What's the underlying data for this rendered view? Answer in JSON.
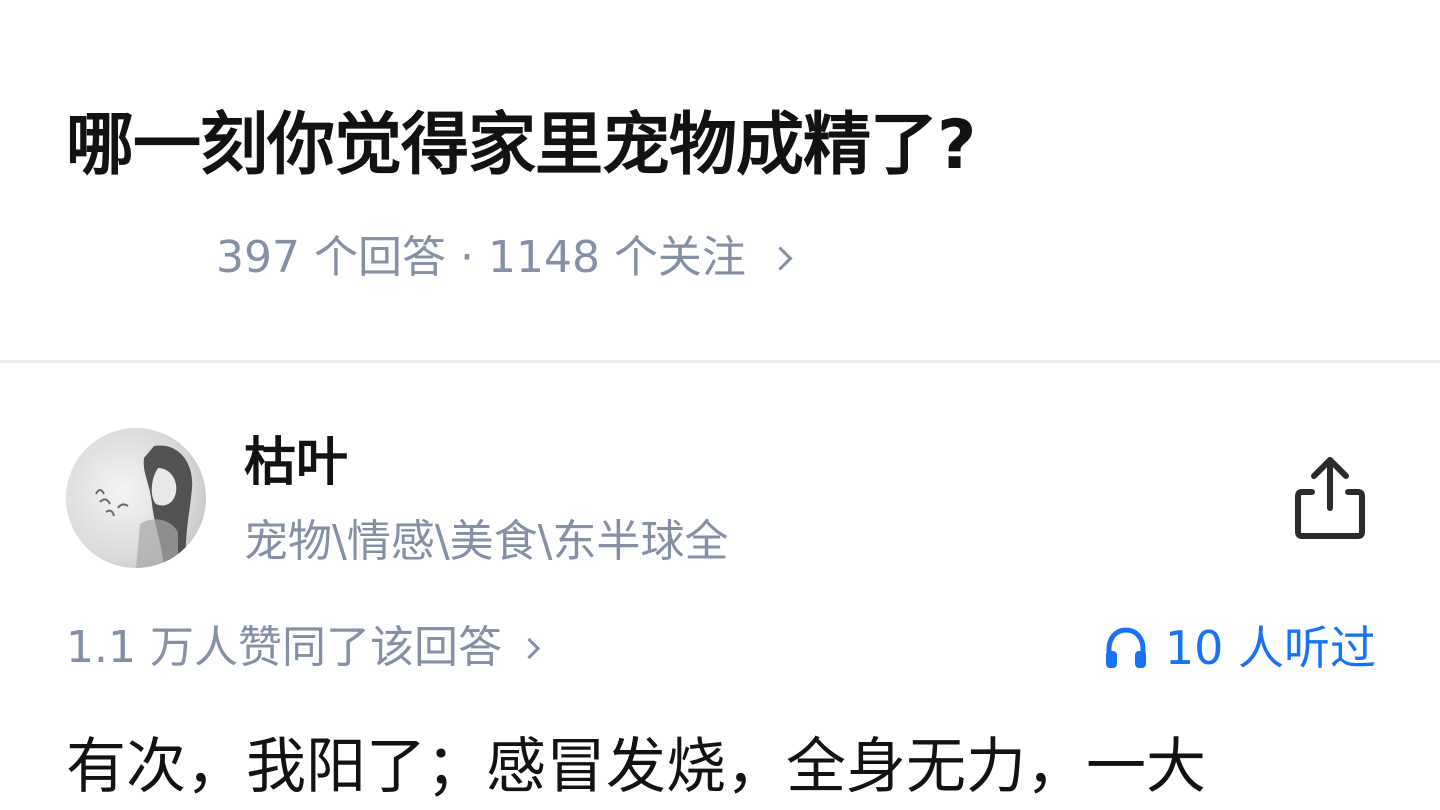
{
  "question": {
    "title": "哪一刻你觉得家里宠物成精了?",
    "answers_count": "397 个回答",
    "separator": "·",
    "followers_count": "1148 个关注"
  },
  "answer": {
    "author_name": "枯叶",
    "author_bio": "宠物\\情感\\美食\\东半球全",
    "upvote_text": "1.1 万人赞同了该回答",
    "listen_text": "10 人听过",
    "body_first_line": "有次，我阳了；感冒发烧，全身无力，一大"
  },
  "icons": {
    "share": "share-icon",
    "headphone": "headphone-icon",
    "chevron": "chevron-right-icon"
  },
  "colors": {
    "primary_text": "#121212",
    "secondary_text": "#8590a6",
    "accent_blue": "#1772f6",
    "divider": "#ececec"
  }
}
